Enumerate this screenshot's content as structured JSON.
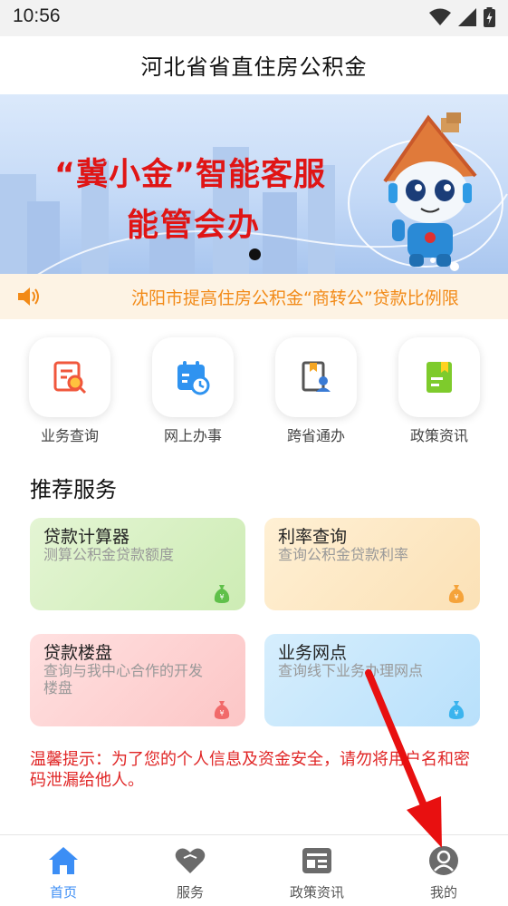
{
  "status_bar": {
    "time": "10:56"
  },
  "header": {
    "title": "河北省省直住房公积金"
  },
  "banner": {
    "line1": "“冀小金”智能客服",
    "line2": "能管会办"
  },
  "notice": {
    "text": "沈阳市提高住房公积金“商转公”贷款比例限"
  },
  "quick_actions": [
    {
      "label": "业务查询",
      "icon": "search-doc-icon"
    },
    {
      "label": "网上办事",
      "icon": "calendar-clock-icon"
    },
    {
      "label": "跨省通办",
      "icon": "book-person-icon"
    },
    {
      "label": "政策资讯",
      "icon": "document-bookmark-icon"
    }
  ],
  "recommended": {
    "title": "推荐服务",
    "cards": [
      {
        "title": "贷款计算器",
        "desc": "测算公积金贷款额度",
        "accent": "#5fc04a"
      },
      {
        "title": "利率查询",
        "desc": "查询公积金贷款利率",
        "accent": "#f5a33a"
      },
      {
        "title": "贷款楼盘",
        "desc": "查询与我中心合作的开发楼盘",
        "accent": "#f16a6a"
      },
      {
        "title": "业务网点",
        "desc": "查询线下业务办理网点",
        "accent": "#3bb4ee"
      }
    ]
  },
  "warning": {
    "text": "温馨提示：为了您的个人信息及资金安全，请勿将用户名和密码泄漏给他人。"
  },
  "tabs": [
    {
      "label": "首页",
      "icon": "home-icon",
      "active": true
    },
    {
      "label": "服务",
      "icon": "heart-icon",
      "active": false
    },
    {
      "label": "政策资讯",
      "icon": "news-icon",
      "active": false
    },
    {
      "label": "我的",
      "icon": "user-icon",
      "active": false
    }
  ],
  "colors": {
    "accent": "#3c8ef5",
    "notice": "#f28a17",
    "warning": "#e02626",
    "annotation_arrow": "#e81010"
  }
}
